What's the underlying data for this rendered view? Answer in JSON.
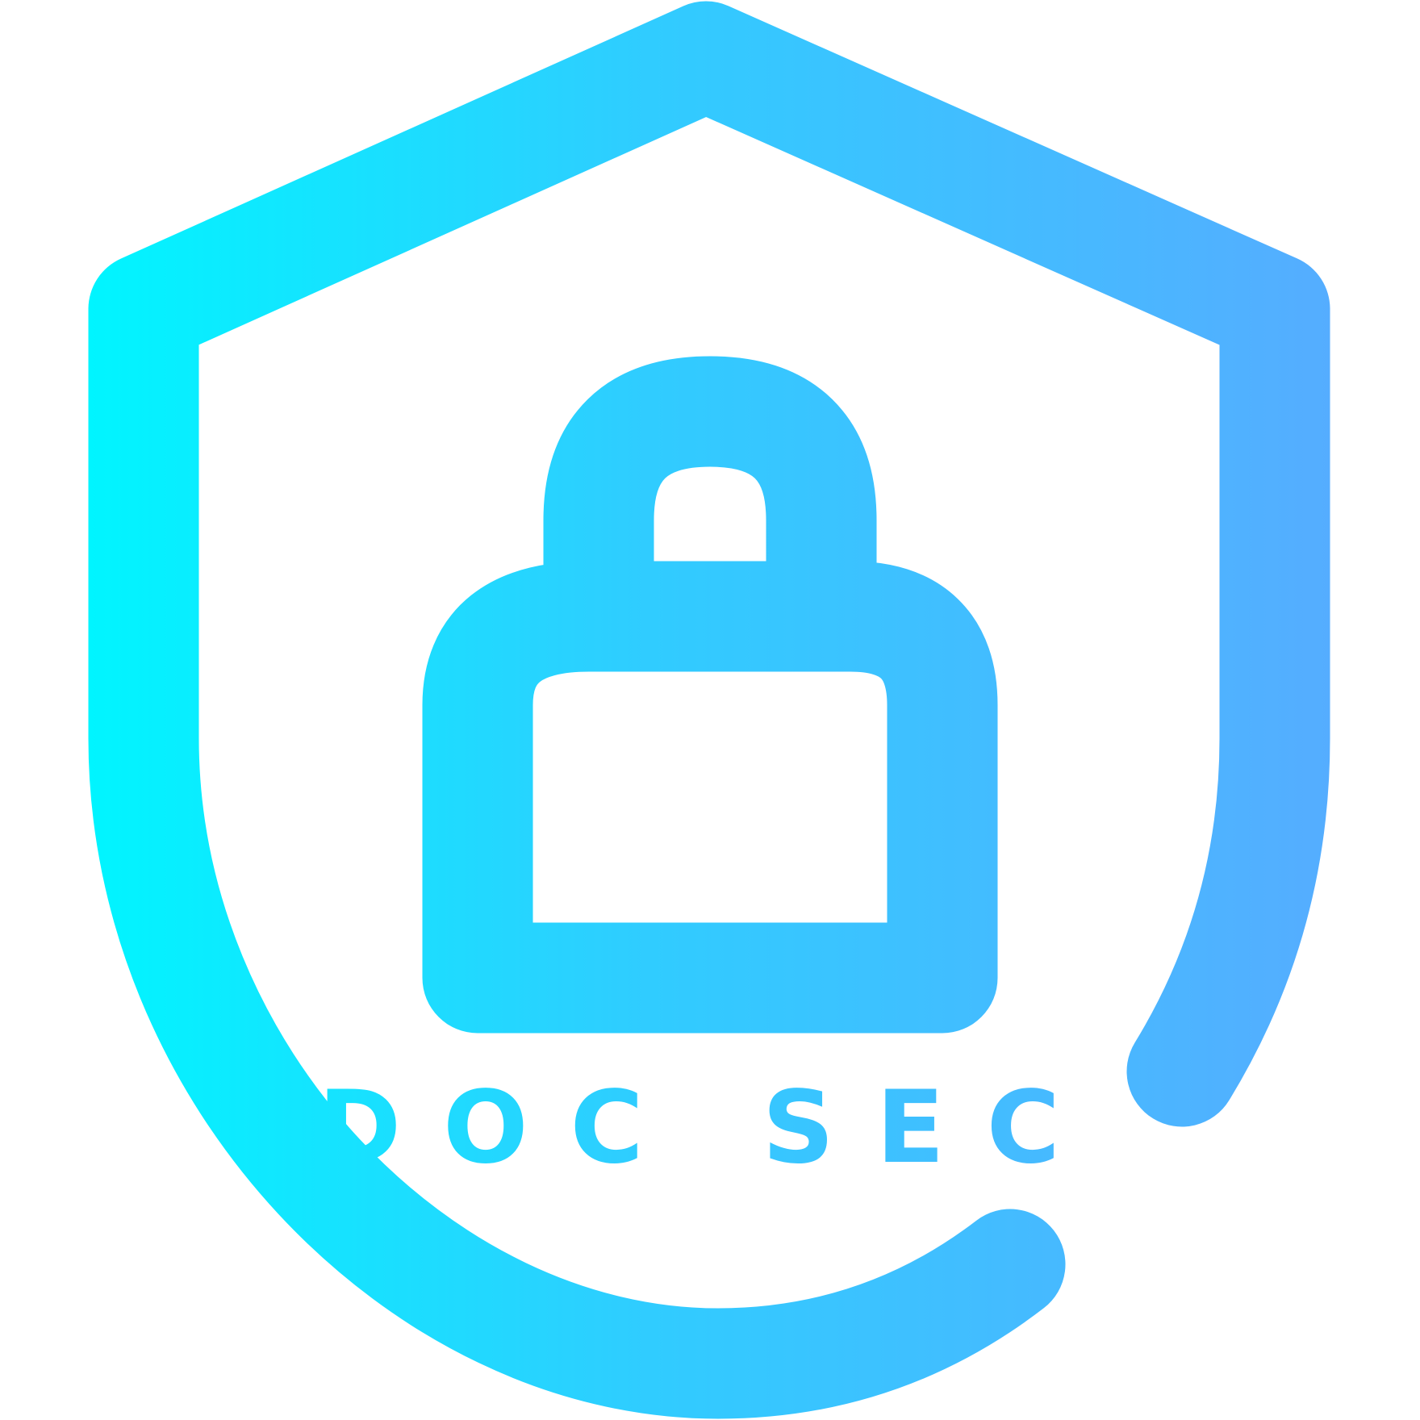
{
  "logo": {
    "wordmark": "DOC SEC",
    "icon": "shield-lock-icon",
    "gradient": {
      "start": "#00F5FF",
      "mid": "#30CCFF",
      "end": "#55ADFF"
    },
    "background": "#FFFFFF"
  }
}
